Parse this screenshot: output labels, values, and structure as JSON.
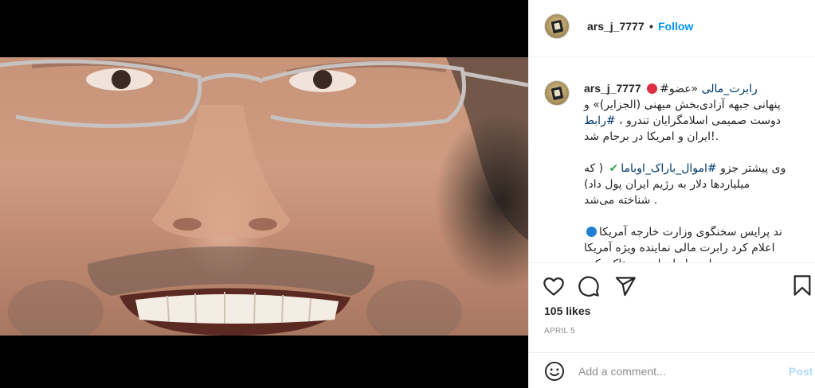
{
  "post": {
    "username": "ars_j_7777",
    "follow_label": "Follow",
    "separator": "•",
    "likes": "105 likes",
    "date": "APRIL 5",
    "comment_placeholder": "Add a comment...",
    "post_label": "Post"
  },
  "caption": {
    "line1_tag": "رابرت_مالی",
    "line1_rest": " «عضو#",
    "line2": "پنهانی جبهه آزادی‌بخش میهنی (الجزایر)» و",
    "line3_text": "دوست صمیمی اسلامگرایان تندرو ، ",
    "line3_tag": "#رابط",
    "line4": ".!ایران و امریکا در برجام شد",
    "para2_line1_prefix": "وی پیشتر جزو ",
    "para2_line1_tag": "#اموال_باراک_اوباما",
    "para2_line1_suffix": " ( که",
    "para2_line2": "میلیاردها دلار به رژیم ایران پول داد)",
    "para2_line3": ". شناخته می‌شد",
    "para3_line1": "ند پرایس سخنگوی وزارت خارجه آمریکا",
    "para3_line2": "اعلام کرد رابرت مالی نماینده ویژه آمریکا",
    "para3_line3": "در امور ایران است و تاکید کرد"
  },
  "icons": {
    "like": "heart-icon",
    "comment": "comment-icon",
    "share": "share-icon",
    "save": "bookmark-icon",
    "emoji": "smiley-icon",
    "avatar": "avatar"
  },
  "colors": {
    "link_blue": "#0095f6",
    "hashtag": "#00376b",
    "muted": "#8e8e8e",
    "post_disabled": "#b3dbff"
  }
}
